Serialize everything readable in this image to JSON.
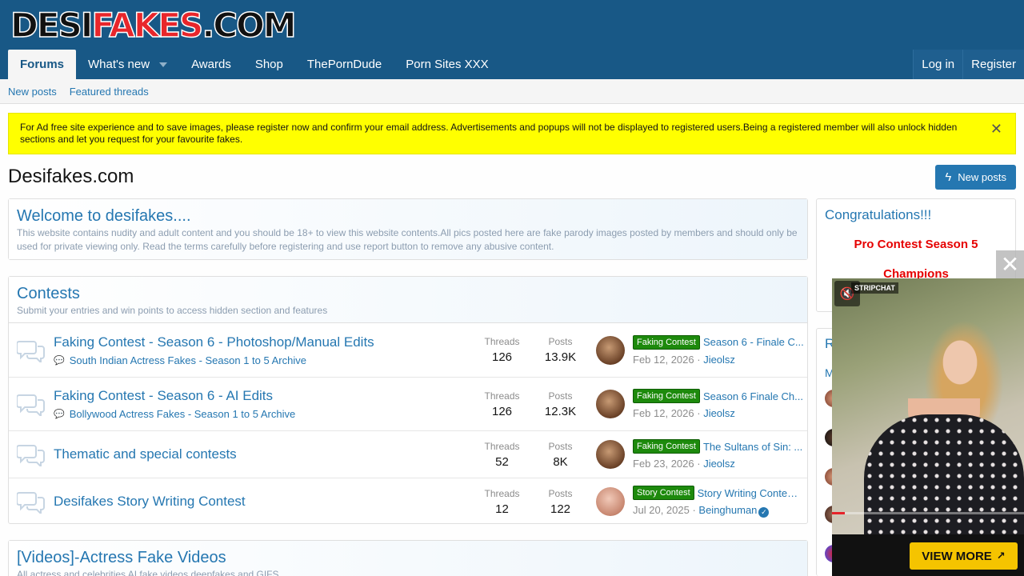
{
  "logo": {
    "part1": "DESI",
    "part2": "FAKES",
    "part3": ".COM"
  },
  "nav": {
    "tabs": [
      "Forums",
      "What's new",
      "Awards",
      "Shop",
      "ThePornDude",
      "Porn Sites XXX"
    ],
    "login": "Log in",
    "register": "Register"
  },
  "subnav": {
    "new_posts": "New posts",
    "featured": "Featured threads"
  },
  "notice": {
    "text": "For Ad free site experience and to save images, please register now and confirm your email address. Advertisements and popups will not be displayed to registered users.Being a registered member will also unlock hidden sections and let you request for your favourite fakes.",
    "close": "✕"
  },
  "page": {
    "title": "Desifakes.com",
    "new_posts_button": "New posts"
  },
  "welcome": {
    "title": "Welcome to desifakes....",
    "desc": "This website contains nudity and adult content and you should be 18+ to view this website contents.All pics posted here are fake parody images posted by members and should only be used for private viewing only. Read the terms carefully before registering and use report button to remove any abusive content."
  },
  "contests": {
    "title": "Contests",
    "desc": "Submit your entries and win points to access hidden section and features",
    "threads_label": "Threads",
    "posts_label": "Posts",
    "nodes": [
      {
        "title": "Faking Contest - Season 6 - Photoshop/Manual Edits",
        "sub": "South Indian Actress Fakes - Season 1 to 5 Archive",
        "threads": "126",
        "posts": "13.9K",
        "label": "Faking Contest",
        "last_title": "Season 6 - Finale C...",
        "date": "Feb 12, 2026",
        "user": "Jieolsz"
      },
      {
        "title": "Faking Contest - Season 6 - AI Edits",
        "sub": "Bollywood Actress Fakes - Season 1 to 5 Archive",
        "threads": "126",
        "posts": "12.3K",
        "label": "Faking Contest",
        "last_title": "Season 6 Finale Ch...",
        "date": "Feb 12, 2026",
        "user": "Jieolsz"
      },
      {
        "title": "Thematic and special contests",
        "sub": "",
        "threads": "52",
        "posts": "8K",
        "label": "Faking Contest",
        "last_title": "The Sultans of Sin: ...",
        "date": "Feb 23, 2026",
        "user": "Jieolsz"
      },
      {
        "title": "Desifakes Story Writing Contest",
        "sub": "",
        "threads": "12",
        "posts": "122",
        "label": "Story Contest",
        "last_title": "Story Writing Contest...",
        "date": "Jul 20, 2025",
        "user": "Beinghuman"
      }
    ]
  },
  "videos": {
    "title": "[Videos]-Actress Fake Videos",
    "desc": "All actress and celebrities AI fake videos deepfakes and GIFS"
  },
  "sidebar": {
    "congrats_title": "Congratulations!!!",
    "line1": "Pro Contest Season 5",
    "line2": "Champions",
    "second_title_initial": "R",
    "second_sub_initial": "M"
  },
  "ad": {
    "brand": "STRIPCHAT",
    "button": "VIEW MORE",
    "close": "✕"
  },
  "colors": {
    "header": "#185886",
    "link": "#2577b1",
    "notice": "#ffff00",
    "label_green": "#1d8a0c",
    "red": "#e60000"
  }
}
